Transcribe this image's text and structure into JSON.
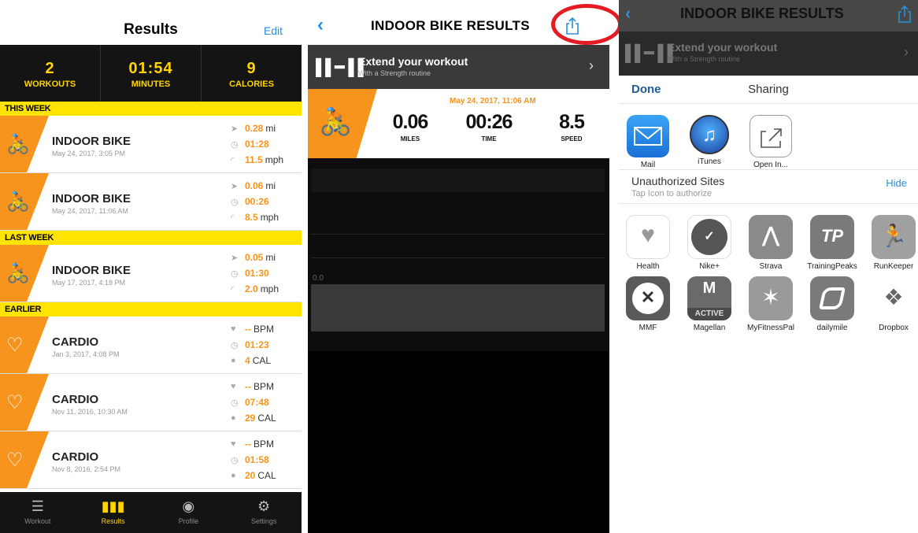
{
  "screen1": {
    "title": "Results",
    "edit_label": "Edit",
    "summary": [
      {
        "value": "2",
        "label": "WORKOUTS"
      },
      {
        "value": "01:54",
        "label": "MINUTES"
      },
      {
        "value": "9",
        "label": "CALORIES"
      }
    ],
    "sections": {
      "this_week": "THIS WEEK",
      "last_week": "LAST WEEK",
      "earlier": "EARLIER"
    },
    "rows": [
      {
        "name": "INDOOR BIKE",
        "date": "May 24, 2017, 3:05 PM",
        "s1": "0.28",
        "u1": "mi",
        "s2": "01:28",
        "s3": "11.5",
        "u3": "mph",
        "icon": "bike-icon"
      },
      {
        "name": "INDOOR BIKE",
        "date": "May 24, 2017, 11:06 AM",
        "s1": "0.06",
        "u1": "mi",
        "s2": "00:26",
        "s3": "8.5",
        "u3": "mph",
        "icon": "bike-icon"
      },
      {
        "name": "INDOOR BIKE",
        "date": "May 17, 2017, 4:18 PM",
        "s1": "0.05",
        "u1": "mi",
        "s2": "01:30",
        "s3": "2.0",
        "u3": "mph",
        "icon": "bike-icon"
      },
      {
        "name": "CARDIO",
        "date": "Jan 3, 2017, 4:08 PM",
        "s1": "--",
        "u1": "BPM",
        "s2": "01:23",
        "s3": "4",
        "u3": "CAL",
        "icon": "heart-icon"
      },
      {
        "name": "CARDIO",
        "date": "Nov 11, 2016, 10:30 AM",
        "s1": "--",
        "u1": "BPM",
        "s2": "07:48",
        "s3": "29",
        "u3": "CAL",
        "icon": "heart-icon"
      },
      {
        "name": "CARDIO",
        "date": "Nov 8, 2016, 2:54 PM",
        "s1": "--",
        "u1": "BPM",
        "s2": "01:58",
        "s3": "20",
        "u3": "CAL",
        "icon": "heart-icon"
      }
    ],
    "tabs": [
      {
        "label": "Workout",
        "icon": "list-icon"
      },
      {
        "label": "Results",
        "icon": "bars-icon"
      },
      {
        "label": "Profile",
        "icon": "profile-icon"
      },
      {
        "label": "Settings",
        "icon": "gear-icon"
      }
    ]
  },
  "screen2": {
    "title": "INDOOR BIKE RESULTS",
    "extend_title": "Extend your workout",
    "extend_sub": "With a Strength routine",
    "datetime": "May 24, 2017, 11:06 AM",
    "metrics": [
      {
        "value": "0.06",
        "label": "MILES"
      },
      {
        "value": "00:26",
        "label": "TIME"
      },
      {
        "value": "8.5",
        "label": "SPEED"
      }
    ],
    "axis_zero": "0.0",
    "highlight_color": "#e41b23"
  },
  "screen3": {
    "title": "INDOOR BIKE RESULTS",
    "extend_title": "Extend your workout",
    "extend_sub": "With a Strength routine",
    "done_label": "Done",
    "sheet_title": "Sharing",
    "share_apps": [
      {
        "label": "Mail",
        "icon": "mail-icon"
      },
      {
        "label": "iTunes",
        "icon": "itunes-icon"
      },
      {
        "label": "Open In...",
        "icon": "open-in-icon"
      }
    ],
    "unauth_title": "Unauthorized Sites",
    "unauth_sub": "Tap Icon to authorize",
    "hide_label": "Hide",
    "sites": [
      {
        "label": "Health",
        "icon": "health-icon"
      },
      {
        "label": "Nike+",
        "icon": "nike-icon"
      },
      {
        "label": "Strava",
        "icon": "strava-icon"
      },
      {
        "label": "TrainingPeaks",
        "icon": "trainingpeaks-icon"
      },
      {
        "label": "RunKeeper",
        "icon": "runkeeper-icon"
      },
      {
        "label": "MMF",
        "icon": "mmf-icon"
      },
      {
        "label": "Magellan",
        "icon": "magellan-icon"
      },
      {
        "label": "MyFitnessPal",
        "icon": "myfitnesspal-icon"
      },
      {
        "label": "dailymile",
        "icon": "dailymile-icon"
      },
      {
        "label": "Dropbox",
        "icon": "dropbox-icon"
      }
    ],
    "logo_text": {
      "tp": "TP",
      "magellan": "M",
      "magellan_active": "ACTIVE"
    }
  },
  "colors": {
    "accent_orange": "#f7941d",
    "accent_yellow": "#ffe400",
    "link_blue": "#2b8fd9"
  }
}
